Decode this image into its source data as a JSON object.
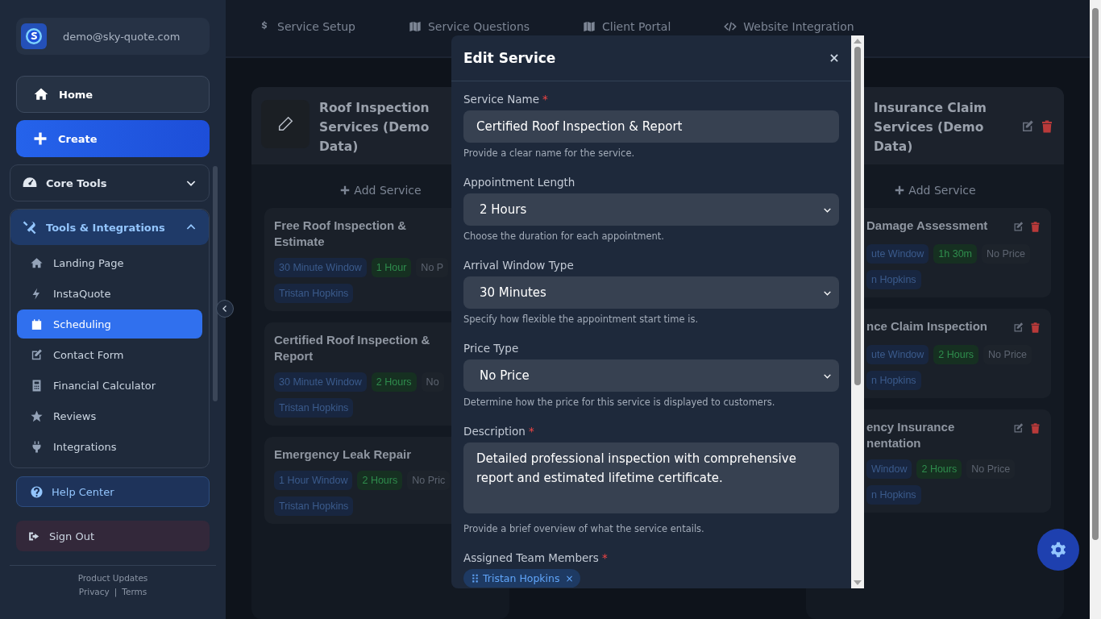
{
  "account": {
    "email": "demo@sky-quote.com"
  },
  "nav": [
    {
      "label": "Home",
      "kind": "plain"
    },
    {
      "label": "Create",
      "kind": "primary"
    }
  ],
  "sections": [
    {
      "label": "Core Tools",
      "expanded": false
    },
    {
      "label": "Tools & Integrations",
      "expanded": true,
      "items": [
        {
          "label": "Landing Page",
          "selected": false
        },
        {
          "label": "InstaQuote",
          "selected": false
        },
        {
          "label": "Scheduling",
          "selected": true
        },
        {
          "label": "Contact Form",
          "selected": false
        },
        {
          "label": "Financial Calculator",
          "selected": false
        },
        {
          "label": "Reviews",
          "selected": false
        },
        {
          "label": "Integrations",
          "selected": false
        }
      ]
    }
  ],
  "help": {
    "label": "Help Center"
  },
  "sign_out": {
    "label": "Sign Out"
  },
  "footer": {
    "updates": "Product Updates",
    "links": [
      "Privacy",
      "Terms"
    ],
    "separator": "|"
  },
  "top_tabs": [
    {
      "label": "Service Setup"
    },
    {
      "label": "Service Questions"
    },
    {
      "label": "Client Portal"
    },
    {
      "label": "Website Integration"
    }
  ],
  "categories": [
    {
      "title": "Roof Inspection Services (Demo Data)",
      "kind": "photo",
      "add_label": "Add Service",
      "cards": [
        {
          "title": "Free Roof Inspection & Estimate",
          "tags": [
            {
              "text": "30 Minute Window",
              "kind": "window"
            },
            {
              "text": "1 Hour",
              "kind": "duration"
            },
            {
              "text": "No P",
              "kind": "price"
            }
          ],
          "members": [
            "Tristan Hopkins"
          ]
        },
        {
          "title": "Certified Roof Inspection & Report",
          "tags": [
            {
              "text": "30 Minute Window",
              "kind": "window"
            },
            {
              "text": "2 Hours",
              "kind": "duration"
            },
            {
              "text": "No",
              "kind": "price"
            }
          ],
          "members": [
            "Tristan Hopkins"
          ]
        },
        {
          "title": "Emergency Leak Repair",
          "tags": [
            {
              "text": "1 Hour Window",
              "kind": "window"
            },
            {
              "text": "2 Hours",
              "kind": "duration"
            },
            {
              "text": "No Pric",
              "kind": "price"
            }
          ],
          "members": [
            "Tristan Hopkins"
          ]
        }
      ]
    },
    {
      "title": "Insurance Claim Services (Demo Data)",
      "kind": "actions",
      "add_label": "Add Service",
      "cards": [
        {
          "title": "Damage Assessment",
          "tags": [
            {
              "text": "ute Window",
              "kind": "window"
            },
            {
              "text": "1h 30m",
              "kind": "duration"
            },
            {
              "text": "No Price",
              "kind": "price"
            }
          ],
          "members": [
            "n Hopkins"
          ]
        },
        {
          "title": "nce Claim Inspection",
          "tags": [
            {
              "text": "ute Window",
              "kind": "window"
            },
            {
              "text": "2 Hours",
              "kind": "duration"
            },
            {
              "text": "No Price",
              "kind": "price"
            }
          ],
          "members": [
            "n Hopkins"
          ]
        },
        {
          "title": "ency Insurance nentation",
          "tags": [
            {
              "text": "Window",
              "kind": "window"
            },
            {
              "text": "2 Hours",
              "kind": "duration"
            },
            {
              "text": "No Price",
              "kind": "price"
            }
          ],
          "members": [
            "n Hopkins"
          ]
        }
      ]
    }
  ],
  "modal": {
    "title": "Edit Service",
    "required_mark": "*",
    "fields": [
      {
        "kind": "text",
        "label": "Service Name",
        "required": true,
        "value": "Certified Roof Inspection & Report",
        "help": "Provide a clear name for the service."
      },
      {
        "kind": "select",
        "label": "Appointment Length",
        "required": false,
        "value": "2 Hours",
        "help": "Choose the duration for each appointment."
      },
      {
        "kind": "select",
        "label": "Arrival Window Type",
        "required": false,
        "value": "30 Minutes",
        "help": "Specify how flexible the appointment start time is."
      },
      {
        "kind": "select",
        "label": "Price Type",
        "required": false,
        "value": "No Price",
        "help": "Determine how the price for this service is displayed to customers."
      },
      {
        "kind": "textarea",
        "label": "Description",
        "required": true,
        "value": "Detailed professional inspection with comprehensive report and estimated lifetime certificate.",
        "help": "Provide a brief overview of what the service entails."
      },
      {
        "kind": "chips",
        "label": "Assigned Team Members",
        "required": true,
        "chips": [
          {
            "text": "Tristan Hopkins",
            "remove": "×"
          }
        ]
      }
    ]
  }
}
